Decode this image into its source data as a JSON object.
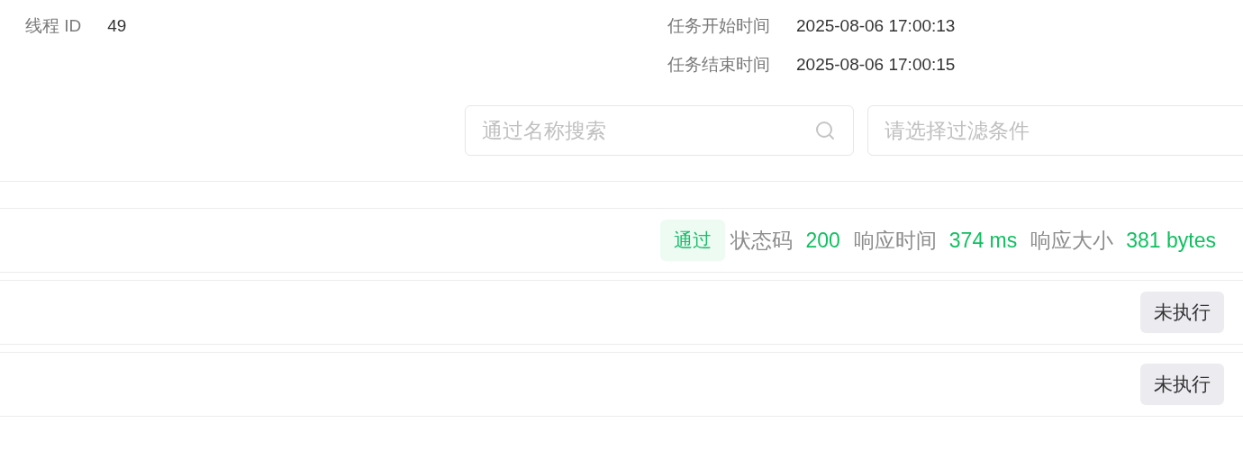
{
  "thread": {
    "label": "线程 ID",
    "value": "49"
  },
  "times": [
    {
      "label": "任务开始时间",
      "value": "2025-08-06 17:00:13"
    },
    {
      "label": "任务结束时间",
      "value": "2025-08-06 17:00:15"
    }
  ],
  "search": {
    "placeholder": "通过名称搜索"
  },
  "filter": {
    "placeholder": "请选择过滤条件"
  },
  "rows": [
    {
      "status": {
        "label": "通过",
        "kind": "passed"
      },
      "metrics": [
        {
          "label": "状态码",
          "value": "200"
        },
        {
          "label": "响应时间",
          "value": "374 ms"
        },
        {
          "label": "响应大小",
          "value": "381 bytes"
        }
      ]
    },
    {
      "status": {
        "label": "未执行",
        "kind": "not_run"
      }
    },
    {
      "status": {
        "label": "未执行",
        "kind": "not_run"
      }
    }
  ]
}
